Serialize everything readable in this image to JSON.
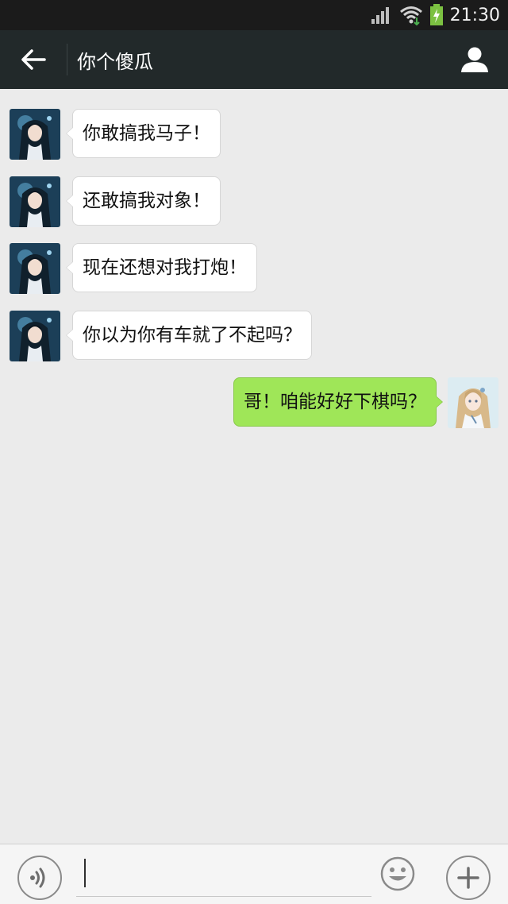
{
  "status_bar": {
    "time": "21:30"
  },
  "header": {
    "title": "你个傻瓜"
  },
  "messages": [
    {
      "side": "left",
      "text": "你敢搞我马子！"
    },
    {
      "side": "left",
      "text": "还敢搞我对象！"
    },
    {
      "side": "left",
      "text": "现在还想对我打炮！"
    },
    {
      "side": "left",
      "text": "你以为你有车就了不起吗？"
    },
    {
      "side": "right",
      "text": "哥！咱能好好下棋吗？"
    }
  ],
  "input": {
    "value": ""
  },
  "icons": {
    "back": "arrow-left-icon",
    "profile": "person-icon",
    "voice": "voice-icon",
    "emoji": "smiley-icon",
    "more": "plus-icon"
  },
  "colors": {
    "title_bar": "#22292a",
    "status_bar": "#1b1b1b",
    "chat_background": "#ebebeb",
    "sent_bubble": "#9fe658",
    "received_bubble": "#ffffff"
  }
}
